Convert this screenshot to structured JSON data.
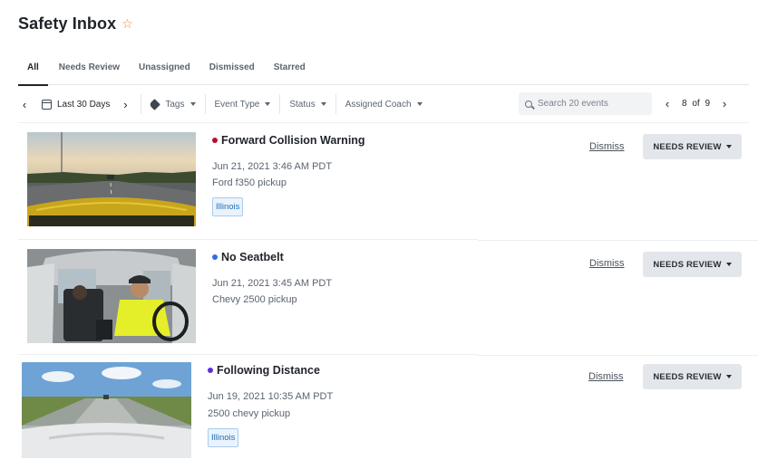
{
  "header": {
    "title": "Safety Inbox",
    "star_icon": "star-outline-icon"
  },
  "tabs": [
    {
      "label": "All",
      "active": true
    },
    {
      "label": "Needs Review",
      "active": false
    },
    {
      "label": "Unassigned",
      "active": false
    },
    {
      "label": "Dismissed",
      "active": false
    },
    {
      "label": "Starred",
      "active": false
    }
  ],
  "toolbar": {
    "date_range": "Last 30 Days",
    "filters": [
      "Tags",
      "Event Type",
      "Status",
      "Assigned Coach"
    ],
    "search_placeholder": "Search 20 events",
    "pager": {
      "current": "8",
      "of": "of",
      "total": "9"
    }
  },
  "events": [
    {
      "title": "Forward Collision Warning",
      "dot_color": "#b3122f",
      "timestamp": "Jun 21, 2021 3:46 AM PDT",
      "vehicle": "Ford f350 pickup",
      "tag": "Illinois",
      "dismiss_label": "Dismiss",
      "status_label": "NEEDS REVIEW"
    },
    {
      "title": "No Seatbelt",
      "dot_color": "#2f6fe0",
      "timestamp": "Jun 21, 2021 3:45 AM PDT",
      "vehicle": "Chevy 2500 pickup",
      "tag": "",
      "dismiss_label": "Dismiss",
      "status_label": "NEEDS REVIEW"
    },
    {
      "title": "Following Distance",
      "dot_color": "#5a2fd6",
      "timestamp": "Jun 19, 2021 10:35 AM PDT",
      "vehicle": "2500 chevy pickup",
      "tag": "Illinois",
      "dismiss_label": "Dismiss",
      "status_label": "NEEDS REVIEW"
    }
  ],
  "colors": {
    "accent_star": "#e8892f",
    "badge_text": "#1e6fb8",
    "status_button_bg": "#e3e6ea"
  }
}
